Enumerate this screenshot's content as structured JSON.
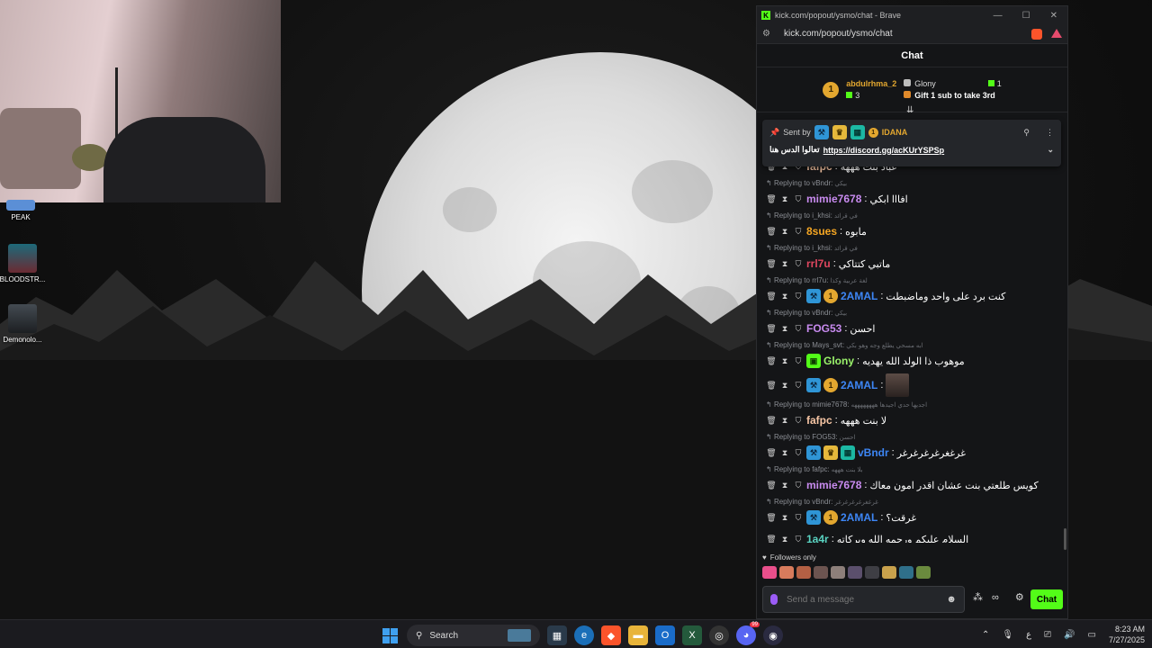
{
  "desktop": {
    "icons": [
      {
        "label": "PEAK",
        "icon": "peak-game-icon",
        "color": "#5b8fd6"
      },
      {
        "label": "BLOODSTR...",
        "icon": "bloodstrike-game-icon",
        "color": "#2b5f6a"
      },
      {
        "label": "Demonolo...",
        "icon": "demonologist-game-icon",
        "color": "#3a4148"
      }
    ]
  },
  "browser": {
    "title": "kick.com/popout/ysmo/chat - Brave",
    "url": "kick.com/popout/ysmo/chat"
  },
  "chat": {
    "header": "Chat",
    "leaderboard": {
      "first": {
        "rank": "1",
        "name": "abdulrhma_2",
        "gifts": "3"
      },
      "second": {
        "name": "Glony",
        "gifts": "1"
      },
      "cta": "Gift 1 sub to take 3rd"
    },
    "pinned": {
      "sent_by_label": "Sent by",
      "badge_rank": "1",
      "author": "IDANA",
      "text": "تعالوا الدس هنا",
      "link": "https://discord.gg/acKUrYSPSp"
    },
    "messages": [
      {
        "reply_user": "",
        "reply_text": "",
        "badges": [],
        "user": "fafpc",
        "user_color": "#f7c6a5",
        "text": "عباد بنت هههه"
      },
      {
        "reply_user": "vBndr",
        "reply_text": "بيكي",
        "badges": [],
        "user": "mimie7678",
        "user_color": "#c98bf0",
        "text": "افااا ابكي"
      },
      {
        "reply_user": "i_khsi",
        "reply_text": "في قرائد",
        "badges": [],
        "user": "8sues",
        "user_color": "#f5a623",
        "text": "مابوه"
      },
      {
        "reply_user": "i_khsi",
        "reply_text": "في قرائد",
        "badges": [],
        "user": "rrl7u",
        "user_color": "#e0475f",
        "text": "ماتبي كتتاكي"
      },
      {
        "reply_user": "rrl7u",
        "reply_text": "لغة عربية وكذا",
        "badges": [
          "vip",
          "og"
        ],
        "user": "2AMAL",
        "user_color": "#3d86f5",
        "text": "كنت برد على واحد وماضبطت"
      },
      {
        "reply_user": "vBndr",
        "reply_text": "بيكي",
        "badges": [],
        "user": "FOG53",
        "user_color": "#c98bf0",
        "text": "احسن"
      },
      {
        "reply_user": "Mays_svt",
        "reply_text": "ابه مسحي يطلع وجه وهو بكي",
        "badges": [
          "gift"
        ],
        "user": "Glony",
        "user_color": "#9af26b",
        "text": "موهوب ذا الولد الله يهديه"
      },
      {
        "reply_user": "",
        "reply_text": "",
        "badges": [
          "vip",
          "og"
        ],
        "user": "2AMAL",
        "user_color": "#3d86f5",
        "text": "",
        "image": true
      },
      {
        "reply_user": "mimie7678",
        "reply_text": "اجديها حدي اجيدها ههههههههه",
        "badges": [],
        "user": "fafpc",
        "user_color": "#f7c6a5",
        "text": "لا بنت هههه"
      },
      {
        "reply_user": "FOG53",
        "reply_text": "احسن",
        "badges": [
          "vip",
          "crown",
          "sub"
        ],
        "user": "vBndr",
        "user_color": "#3d86f5",
        "text": "غرغغرغرغرغرغر"
      },
      {
        "reply_user": "fafpc",
        "reply_text": "بلا بنت هههه",
        "badges": [],
        "user": "mimie7678",
        "user_color": "#c98bf0",
        "text": "كويس طلعتي بنت عشان اقدر امون معاك"
      },
      {
        "reply_user": "vBndr",
        "reply_text": "غرغغرغرغرغرغر",
        "badges": [
          "vip",
          "og"
        ],
        "user": "2AMAL",
        "user_color": "#3d86f5",
        "text": "غرقت؟"
      },
      {
        "reply_user": "",
        "reply_text": "",
        "badges": [],
        "user": "1a4r",
        "user_color": "#5ad4c2",
        "text": "السلام عليكم ورحمه الله وبركاته"
      }
    ],
    "replying_label": "Replying to",
    "followers_only": "Followers only",
    "emotes": [
      "#e84f8b",
      "#d77b5c",
      "#b46044",
      "#6c5450",
      "#8d7f7a",
      "#5b4f6c",
      "#3e3e44",
      "#c8a14c",
      "#2f6f8a",
      "#6a8a3e"
    ],
    "composer_placeholder": "Send a message",
    "chat_button": "Chat"
  },
  "taskbar": {
    "search_label": "Search",
    "time": "8:23 AM",
    "date": "7/27/2025",
    "lang": "ع",
    "discord_badge": "99"
  }
}
